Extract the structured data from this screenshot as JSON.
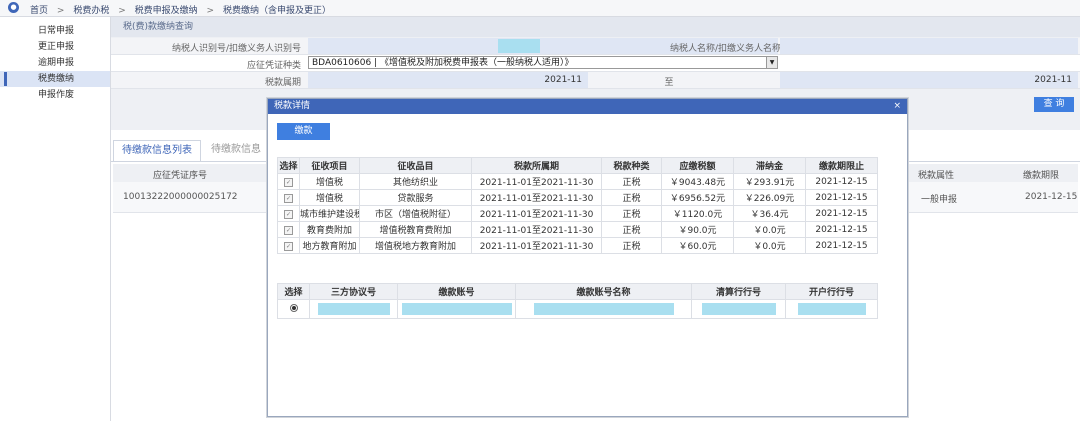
{
  "breadcrumb": [
    "首页",
    "税费办税",
    "税费申报及缴纳",
    "税费缴纳（含申报及更正）"
  ],
  "sidebar": {
    "items": [
      "日常申报",
      "更正申报",
      "逾期申报",
      "税费缴纳",
      "申报作废"
    ],
    "active_index": 3
  },
  "query": {
    "panel_title": "税(费)款缴纳查询",
    "taxpayer_id_label": "纳税人识别号/扣缴义务人识别号",
    "taxpayer_name_label": "纳税人名称/扣缴义务人名称",
    "voucher_type_label": "应征凭证种类",
    "voucher_type_value": "BDA0610606 | 《增值税及附加税费申报表（一般纳税人适用）》",
    "period_label": "税款属期",
    "period_from": "2021-11",
    "period_to_label": "至",
    "period_to": "2021-11",
    "query_button": "查 询"
  },
  "tabs": {
    "pending": "待缴款信息列表",
    "other": "待缴款信息"
  },
  "background_table": {
    "col1_header": "应征凭证序号",
    "col2_header": "税款属性",
    "col3_header": "缴款期限",
    "row": {
      "voucher_no": "10013222000000025172",
      "tax_attr": "一般申报",
      "deadline": "2021-12-15"
    }
  },
  "modal": {
    "title": "税款详情",
    "close_icon": "close-icon",
    "pay_button": "缴款",
    "headers": [
      "选择",
      "征收项目",
      "征收品目",
      "税款所属期",
      "税款种类",
      "应缴税额",
      "滞纳金",
      "缴款期限止"
    ],
    "rows": [
      {
        "item": "增值税",
        "category": "其他纺织业",
        "period": "2021-11-01至2021-11-30",
        "kind": "正税",
        "amount": "￥9043.48元",
        "late_fee": "￥293.91元",
        "deadline": "2021-12-15"
      },
      {
        "item": "增值税",
        "category": "贷款服务",
        "period": "2021-11-01至2021-11-30",
        "kind": "正税",
        "amount": "￥6956.52元",
        "late_fee": "￥226.09元",
        "deadline": "2021-12-15"
      },
      {
        "item": "城市维护建设税",
        "category": "市区（增值税附征）",
        "period": "2021-11-01至2021-11-30",
        "kind": "正税",
        "amount": "￥1120.0元",
        "late_fee": "￥36.4元",
        "deadline": "2021-12-15"
      },
      {
        "item": "教育费附加",
        "category": "增值税教育费附加",
        "period": "2021-11-01至2021-11-30",
        "kind": "正税",
        "amount": "￥90.0元",
        "late_fee": "￥0.0元",
        "deadline": "2021-12-15"
      },
      {
        "item": "地方教育附加",
        "category": "增值税地方教育附加",
        "period": "2021-11-01至2021-11-30",
        "kind": "正税",
        "amount": "￥60.0元",
        "late_fee": "￥0.0元",
        "deadline": "2021-12-15"
      }
    ],
    "account_headers": [
      "选择",
      "三方协议号",
      "缴款账号",
      "缴款账号名称",
      "清算行行号",
      "开户行行号"
    ]
  }
}
